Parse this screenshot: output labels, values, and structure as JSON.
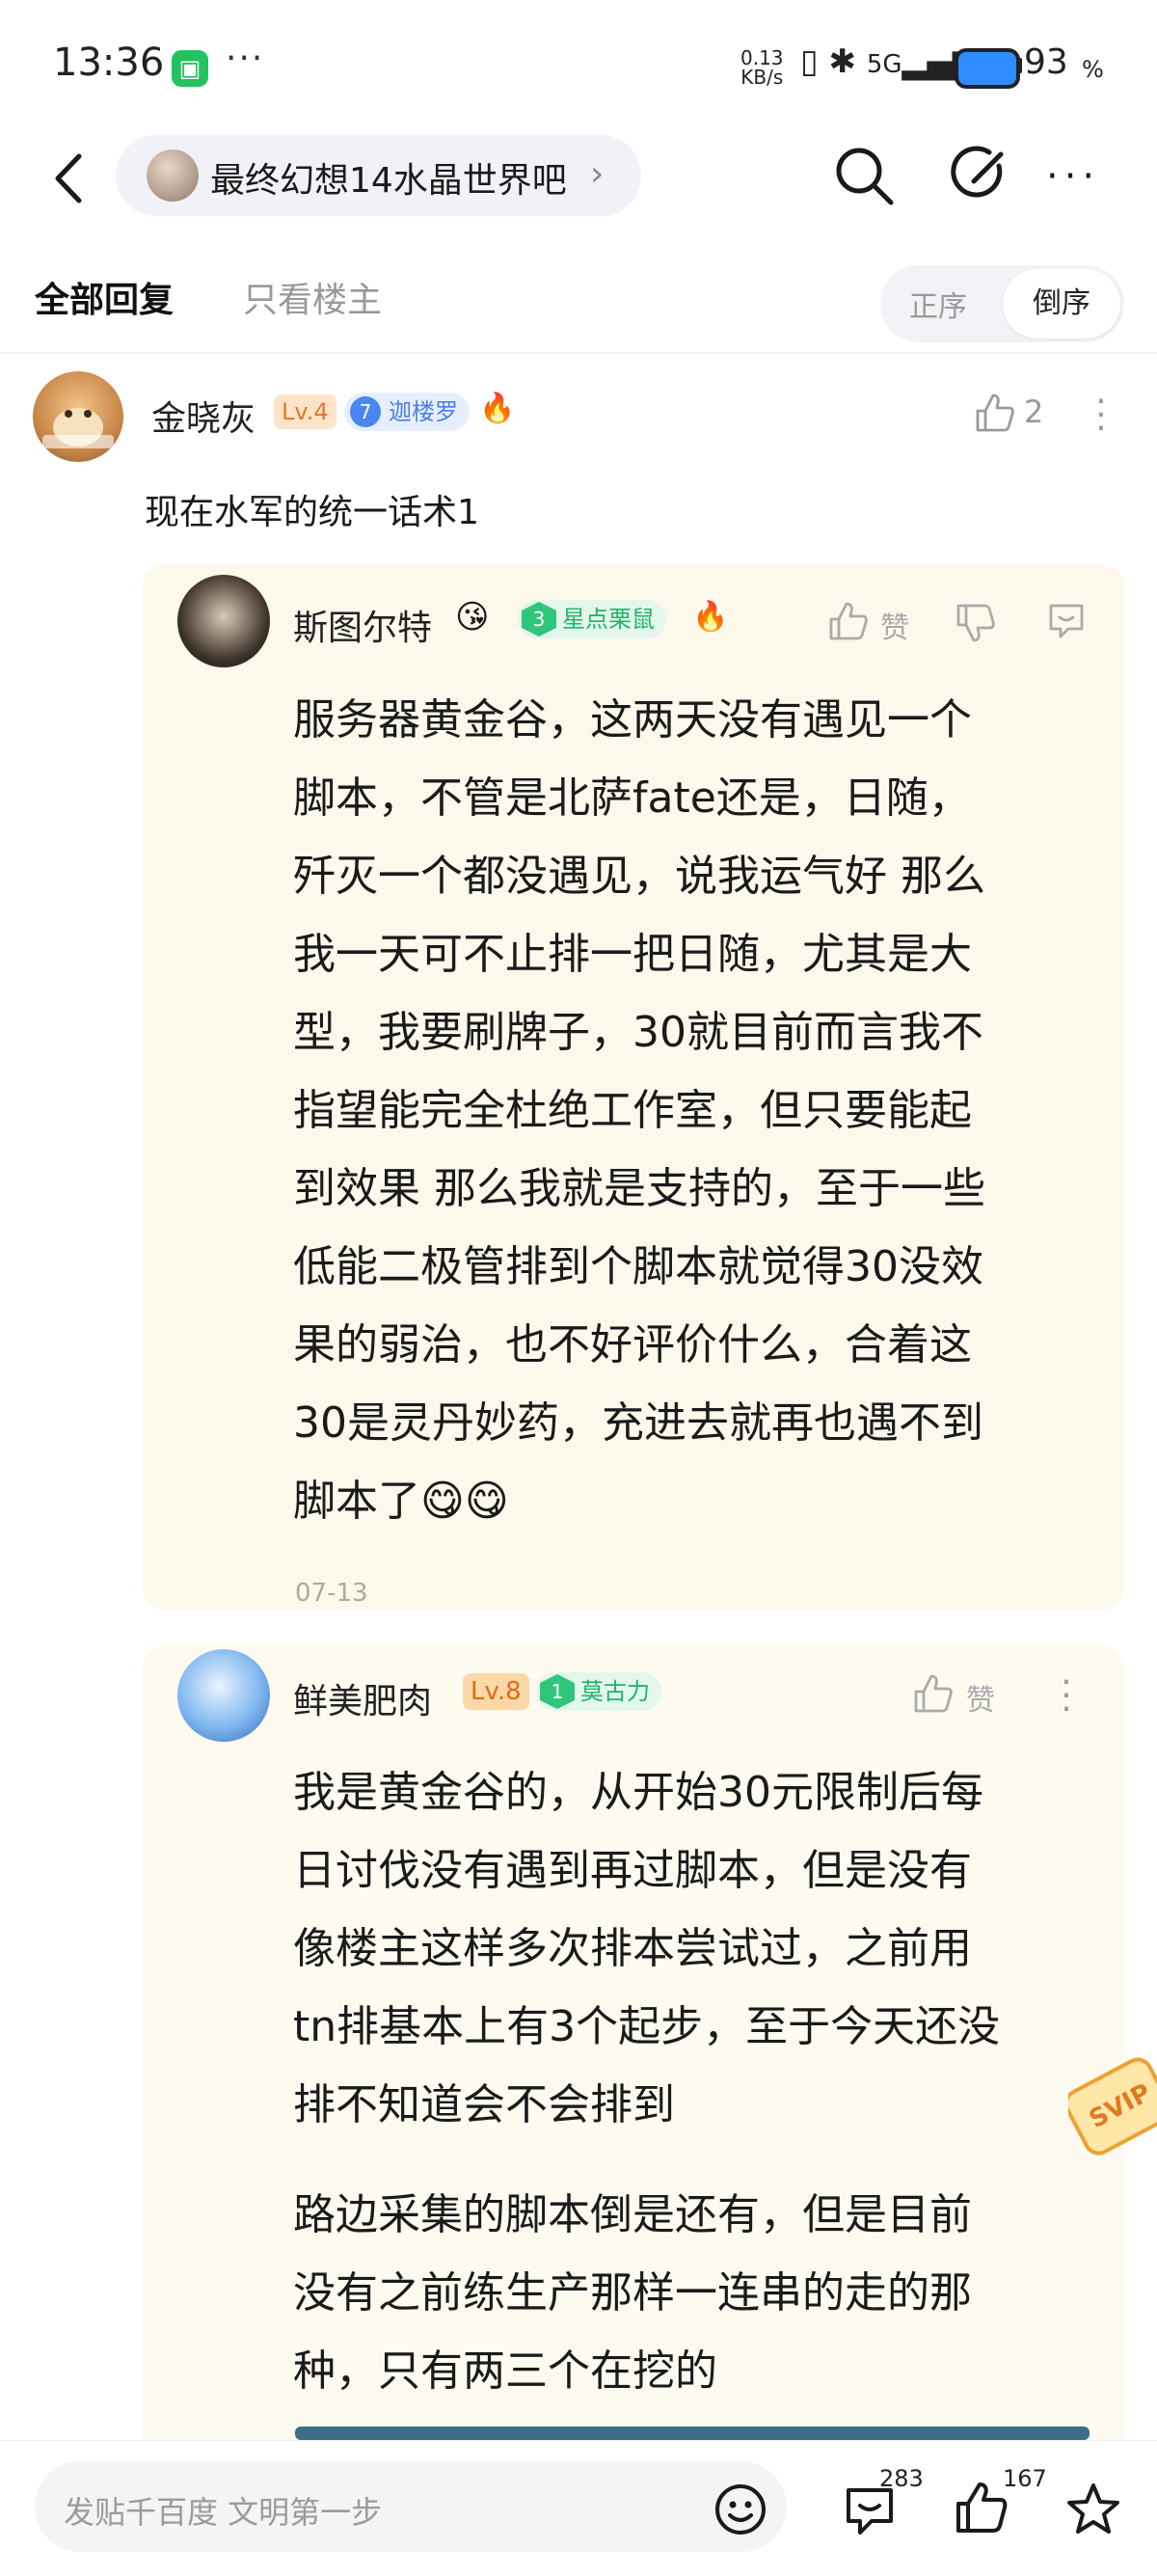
{
  "status_bar": {
    "time": "13:36",
    "app_icon": "app-notification-icon",
    "more": "···",
    "network_speed_value": "0.13",
    "network_speed_unit": "KB/s",
    "battery": "93",
    "battery_unit": "%"
  },
  "nav": {
    "forum_name": "最终幻想14水晶世界吧",
    "chevron": "›",
    "more": "···"
  },
  "tabs": {
    "all_replies": "全部回复",
    "only_op": "只看楼主",
    "sort_asc": "正序",
    "sort_desc": "倒序"
  },
  "post": {
    "username": "金晓灰",
    "level": "Lv.4",
    "title_level": "7",
    "title_name": "迦楼罗",
    "fire_emoji": "🔥",
    "like_count": "2",
    "content": "现在水军的统一话术1"
  },
  "replies": [
    {
      "username": "斯图尔特",
      "emoji": "😘",
      "badge_level": "3",
      "badge_name": "星点栗鼠",
      "fire_emoji": "🔥",
      "zan_label": "赞",
      "lines": [
        "服务器黄金谷，这两天没有遇见一个",
        "脚本，不管是北萨fate还是，日随，",
        "歼灭一个都没遇见，说我运气好 那么",
        "我一天可不止排一把日随，尤其是大",
        "型，我要刷牌子，30就目前而言我不",
        "指望能完全杜绝工作室，但只要能起",
        "到效果 那么我就是支持的，至于一些",
        "低能二极管排到个脚本就觉得30没效",
        "果的弱治，也不好评价什么，合着这",
        "30是灵丹妙药，充进去就再也遇不到",
        "脚本了😋😋"
      ],
      "date": "07-13"
    },
    {
      "username": "鲜美肥肉",
      "level": "Lv.8",
      "badge_level": "1",
      "badge_name": "莫古力",
      "zan_label": "赞",
      "paragraph1": [
        "我是黄金谷的，从开始30元限制后每",
        "日讨伐没有遇到再过脚本，但是没有",
        "像楼主这样多次排本尝试过，之前用",
        "tn排基本上有3个起步，至于今天还没",
        "排不知道会不会排到"
      ],
      "paragraph2": [
        "路边采集的脚本倒是还有，但是目前",
        "没有之前练生产那样一连串的走的那",
        "种，只有两三个在挖的"
      ]
    }
  ],
  "sticker": {
    "text": "SVIP"
  },
  "bottom_bar": {
    "placeholder": "发贴千百度 文明第一步",
    "comment_count": "283",
    "like_count": "167"
  },
  "colors": {
    "accent_blue": "#4a86f0",
    "badge_green": "#2fc67c",
    "card_bg": "#fcf8ec",
    "level_orange": "#e07a2b"
  }
}
